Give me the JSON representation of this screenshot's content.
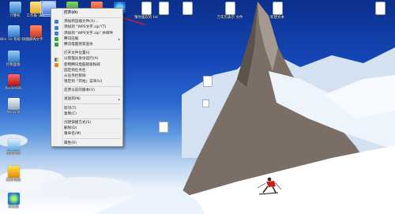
{
  "desktop_icons": [
    {
      "label": "计算机",
      "icon": "computer-icon"
    },
    {
      "label": "工作报 Lea",
      "icon": "folder-icon"
    },
    {
      "label": "",
      "icon": "selected-file-icon"
    },
    {
      "label": "",
      "icon": "green-app-icon"
    },
    {
      "label": "",
      "icon": "photo-app-icon"
    },
    {
      "label": "",
      "icon": "internet-explorer-icon"
    },
    {
      "label": "",
      "icon": "control-panel-icon"
    },
    {
      "label": "猜你喜欢的.txt",
      "icon": "text-file-icon"
    },
    {
      "label": "",
      "icon": "document-icon"
    },
    {
      "label": "",
      "icon": "document-icon"
    },
    {
      "label": "万年历表示 文件",
      "icon": "document-icon"
    },
    {
      "label": "新建文本",
      "icon": "text-file-icon"
    },
    {
      "label": "",
      "icon": "document-icon"
    },
    {
      "label": "Win 10 系统-快捷方式",
      "icon": "system-icon"
    },
    {
      "label": "WPS文字",
      "icon": "wps-writer-icon"
    },
    {
      "label": "控制面板",
      "icon": "control-panel-icon"
    },
    {
      "label": "RocketDk",
      "icon": "rocket-icon"
    },
    {
      "label": "Recycle",
      "icon": "recycle-bin-icon"
    },
    {
      "label": "百度网盘",
      "icon": "cloud-icon"
    },
    {
      "label": "腾讯电脑",
      "icon": "yellow-app-icon"
    },
    {
      "label": "浏览器",
      "icon": "browser-icon"
    }
  ],
  "context_menu": {
    "items": [
      {
        "label": "打开(O)",
        "icon": "",
        "bold": true
      },
      {
        "label": "添加到压缩文件(A)...",
        "icon": "archive-icon"
      },
      {
        "label": "添加到 \"WPS文字.zip\"(T)",
        "icon": "archive-icon"
      },
      {
        "label": "添加到 \"WPS文字.zip\" 并邮件",
        "icon": "archive-icon"
      },
      {
        "label": "腾讯压缩",
        "icon": "compress-icon",
        "submenu": true
      },
      {
        "label": "腾讯电脑管家查杀",
        "icon": "shield-icon"
      },
      {
        "label": "打开文件位置(I)",
        "icon": ""
      },
      {
        "label": "以管理员身份运行(A)",
        "icon": "admin-shield-icon"
      },
      {
        "label": "使用腾讯电脑管家粉碎",
        "icon": "shred-icon"
      },
      {
        "label": "固定到任务栏",
        "icon": ""
      },
      {
        "label": "从任务栏移除",
        "icon": ""
      },
      {
        "label": "锁定到「开始」菜单(U)",
        "icon": ""
      },
      {
        "label": "还原以前的版本(V)",
        "icon": ""
      },
      {
        "label": "发送到(N)",
        "icon": "",
        "submenu": true
      },
      {
        "label": "剪切(T)",
        "icon": ""
      },
      {
        "label": "复制(C)",
        "icon": ""
      },
      {
        "label": "创建快捷方式(S)",
        "icon": ""
      },
      {
        "label": "删除(D)",
        "icon": ""
      },
      {
        "label": "重命名(M)",
        "icon": ""
      },
      {
        "label": "属性(R)",
        "icon": ""
      }
    ],
    "submenu_arrow": "▸"
  },
  "colors": {
    "annotation_arrow": "#e02020",
    "menu_bg": "#f0f0f0"
  }
}
